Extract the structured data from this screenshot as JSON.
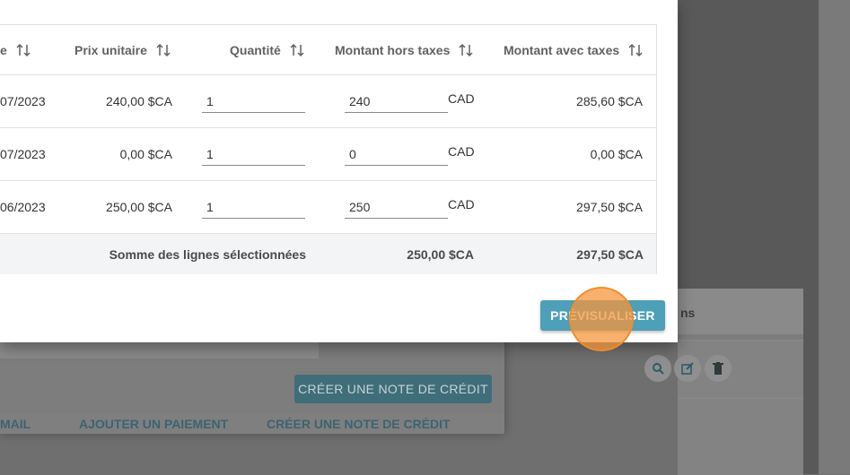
{
  "table": {
    "headers": {
      "date_partial": "e",
      "unit_price": "Prix unitaire",
      "quantity": "Quantité",
      "amount_excl_tax": "Montant hors taxes",
      "amount_incl_tax": "Montant avec taxes"
    },
    "rows": [
      {
        "date": "07/2023",
        "unit_price": "240,00 $CA",
        "quantity": "1",
        "amount": "240",
        "currency": "CAD",
        "amount_incl_tax": "285,60 $CA"
      },
      {
        "date": "07/2023",
        "unit_price": "0,00 $CA",
        "quantity": "1",
        "amount": "0",
        "currency": "CAD",
        "amount_incl_tax": "0,00 $CA"
      },
      {
        "date": "06/2023",
        "unit_price": "250,00 $CA",
        "quantity": "1",
        "amount": "250",
        "currency": "CAD",
        "amount_incl_tax": "297,50 $CA"
      }
    ],
    "footer": {
      "label": "Somme des lignes sélectionnées",
      "total_excl_tax": "250,00 $CA",
      "total_incl_tax": "297,50 $CA"
    }
  },
  "actions": {
    "preview_label": "PRÉVISUALISER"
  },
  "background": {
    "credit_button": "CRÉER UNE NOTE DE CRÉDIT",
    "tabs": [
      "MAIL",
      "AJOUTER UN PAIEMENT",
      "CRÉER UNE NOTE DE CRÉDIT"
    ],
    "card_header_partial": "ns"
  },
  "icons": [
    "sort-icon",
    "search-icon",
    "edit-icon",
    "delete-icon"
  ],
  "colors": {
    "primary": "#4e9fb8",
    "click_marker": "#f5963c"
  }
}
